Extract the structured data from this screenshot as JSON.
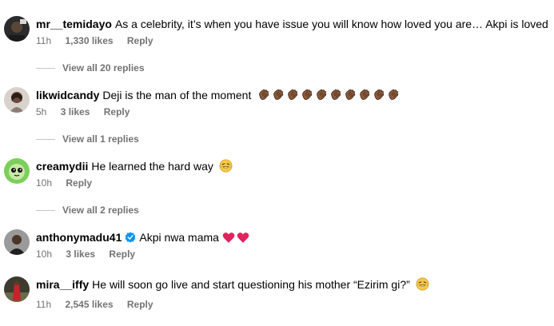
{
  "comments": [
    {
      "username": "mr__temidayo",
      "text": "As a celebrity, it’s when you have issue you will know how loved you are… Akpi is loved",
      "time": "11h",
      "likes": "1,330 likes",
      "reply": "Reply",
      "view_replies": "View all 20 replies"
    },
    {
      "username": "likwidcandy",
      "text": "Deji is the man of the moment",
      "emoji_name": "clapping-hands-emoji",
      "emoji_count": 10,
      "time": "5h",
      "likes": "3 likes",
      "reply": "Reply",
      "view_replies": "View all 1 replies"
    },
    {
      "username": "creamydii",
      "text": "He learned the hard way",
      "emoji_name": "laughing-tears-emoji",
      "time": "10h",
      "reply": "Reply",
      "view_replies": "View all 2 replies"
    },
    {
      "username": "anthonymadu41",
      "verified": true,
      "text": "Akpi nwa mama",
      "emoji_name": "red-heart-emoji",
      "time": "10h",
      "likes": "3 likes",
      "reply": "Reply"
    },
    {
      "username": "mira__iffy",
      "text": "He will soon go live and start questioning his mother “Ezirim gi?”",
      "emoji_name": "laughing-tears-emoji",
      "time": "11h",
      "likes": "2,545 likes",
      "reply": "Reply"
    }
  ],
  "colors": {
    "meta_text": "#737373",
    "verified_badge": "#0095f6",
    "heart": "#e0245e"
  }
}
